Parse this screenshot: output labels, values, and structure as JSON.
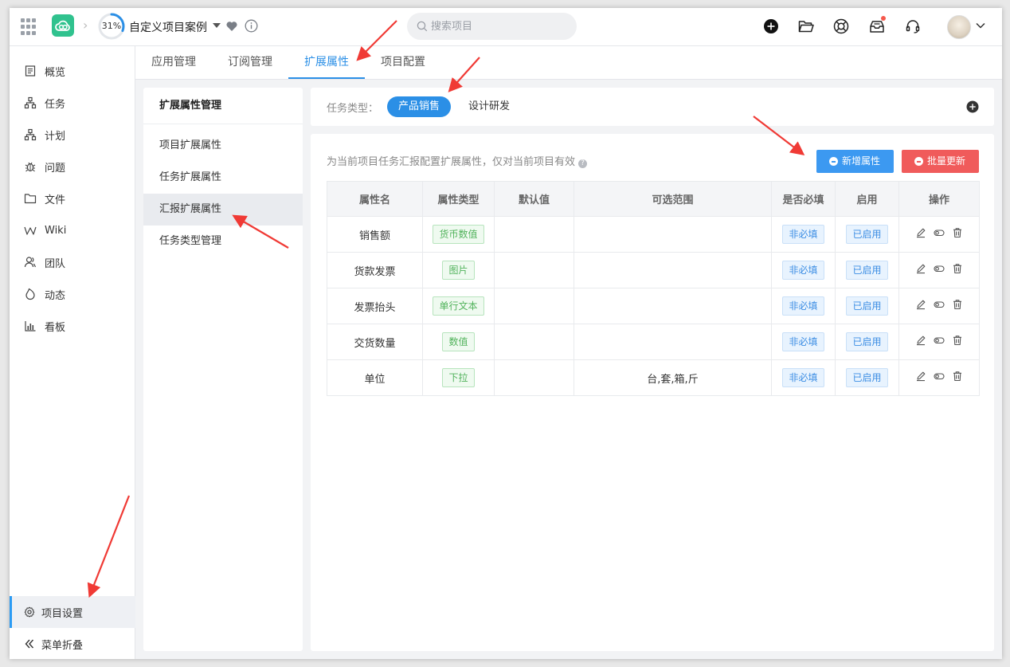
{
  "header": {
    "progress": "31%",
    "progress_value": 31,
    "project_title": "自定义项目案例",
    "search_placeholder": "搜索项目"
  },
  "sidebar": {
    "items": [
      {
        "label": "概览",
        "icon": "overview-icon"
      },
      {
        "label": "任务",
        "icon": "task-icon"
      },
      {
        "label": "计划",
        "icon": "plan-icon"
      },
      {
        "label": "问题",
        "icon": "bug-icon"
      },
      {
        "label": "文件",
        "icon": "folder-icon"
      },
      {
        "label": "Wiki",
        "icon": "wiki-icon"
      },
      {
        "label": "团队",
        "icon": "team-icon"
      },
      {
        "label": "动态",
        "icon": "activity-icon"
      },
      {
        "label": "看板",
        "icon": "board-icon"
      }
    ],
    "settings_label": "项目设置",
    "collapse_label": "菜单折叠"
  },
  "tabs": [
    {
      "label": "应用管理"
    },
    {
      "label": "订阅管理"
    },
    {
      "label": "扩展属性",
      "active": true
    },
    {
      "label": "项目配置"
    }
  ],
  "subpanel": {
    "title": "扩展属性管理",
    "items": [
      {
        "label": "项目扩展属性"
      },
      {
        "label": "任务扩展属性"
      },
      {
        "label": "汇报扩展属性",
        "active": true
      },
      {
        "label": "任务类型管理"
      }
    ]
  },
  "typebar": {
    "label": "任务类型：",
    "types": [
      {
        "label": "产品销售",
        "active": true
      },
      {
        "label": "设计研发"
      }
    ]
  },
  "main": {
    "hint": "为当前项目任务汇报配置扩展属性，仅对当前项目有效",
    "add_button": "新增属性",
    "batch_button": "批量更新",
    "columns": [
      "属性名",
      "属性类型",
      "默认值",
      "可选范围",
      "是否必填",
      "启用",
      "操作"
    ],
    "rows": [
      {
        "name": "销售额",
        "type": "货币数值",
        "default": "",
        "range": "",
        "required": "非必填",
        "enabled": "已启用"
      },
      {
        "name": "货款发票",
        "type": "图片",
        "default": "",
        "range": "",
        "required": "非必填",
        "enabled": "已启用"
      },
      {
        "name": "发票抬头",
        "type": "单行文本",
        "default": "",
        "range": "",
        "required": "非必填",
        "enabled": "已启用"
      },
      {
        "name": "交货数量",
        "type": "数值",
        "default": "",
        "range": "",
        "required": "非必填",
        "enabled": "已启用"
      },
      {
        "name": "单位",
        "type": "下拉",
        "default": "",
        "range": "台,套,箱,斤",
        "required": "非必填",
        "enabled": "已启用"
      }
    ]
  },
  "colors": {
    "accent": "#2b8fe6",
    "primary_button": "#3c99f1",
    "danger_button": "#f05b5b",
    "tag_green": "#52b35c",
    "tag_blue": "#3d8ee4",
    "annotation_arrow": "#f03a35"
  }
}
